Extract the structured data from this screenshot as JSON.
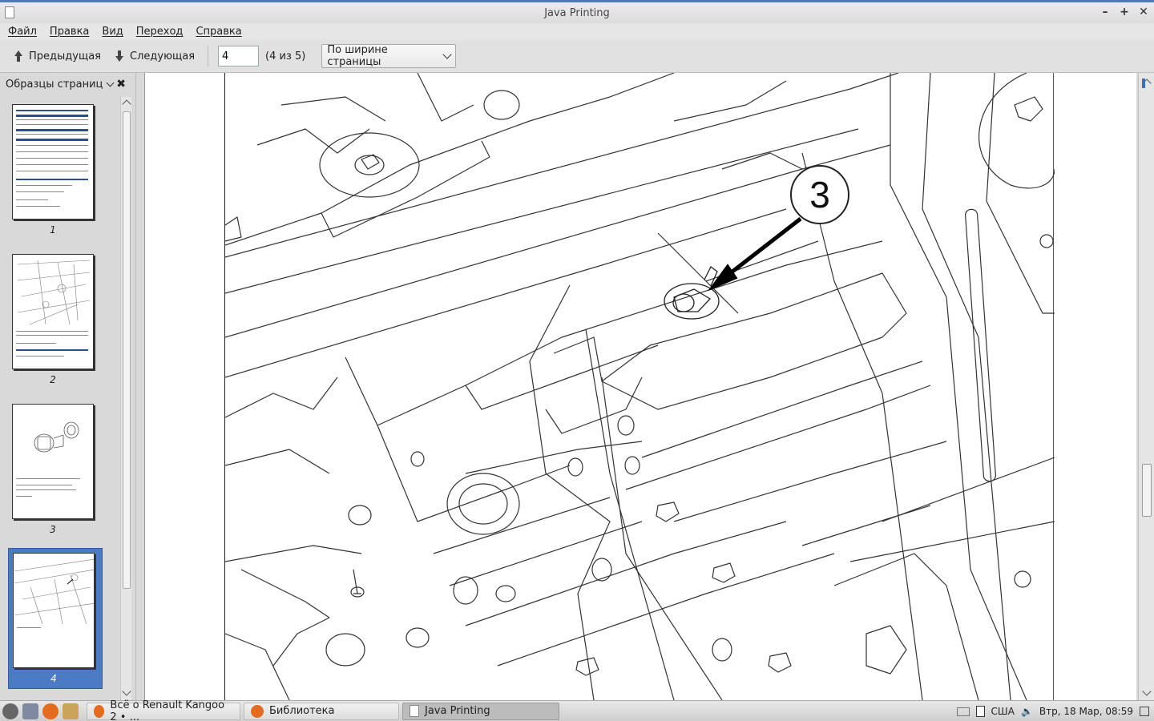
{
  "window": {
    "title": "Java Printing"
  },
  "menu": [
    {
      "label": "Файл"
    },
    {
      "label": "Правка"
    },
    {
      "label": "Вид"
    },
    {
      "label": "Переход"
    },
    {
      "label": "Справка"
    }
  ],
  "toolbar": {
    "prev_label": "Предыдущая",
    "next_label": "Следующая",
    "page_value": "4",
    "page_count": "(4 из 5)",
    "zoom_selected": "По ширине страницы"
  },
  "sidebar": {
    "title": "Образцы страниц",
    "thumbnails": [
      {
        "num": "1"
      },
      {
        "num": "2"
      },
      {
        "num": "3"
      },
      {
        "num": "4"
      }
    ],
    "selected_page": "4"
  },
  "document": {
    "callout_number": "3"
  },
  "taskbar": {
    "tasks": [
      {
        "label": "Всё о Renault Kangoo 2 • ..."
      },
      {
        "label": "Библиотека"
      },
      {
        "label": "Java Printing"
      }
    ],
    "layout": "США",
    "clock": "Втр, 18 Мар, 08:59"
  },
  "icons": {
    "app": "document-icon",
    "prev": "arrow-up-icon",
    "next": "arrow-down-icon",
    "close_sidebar": "close-icon",
    "mail": "mail-icon",
    "clipboard": "clipboard-icon",
    "volume": "volume-icon"
  }
}
